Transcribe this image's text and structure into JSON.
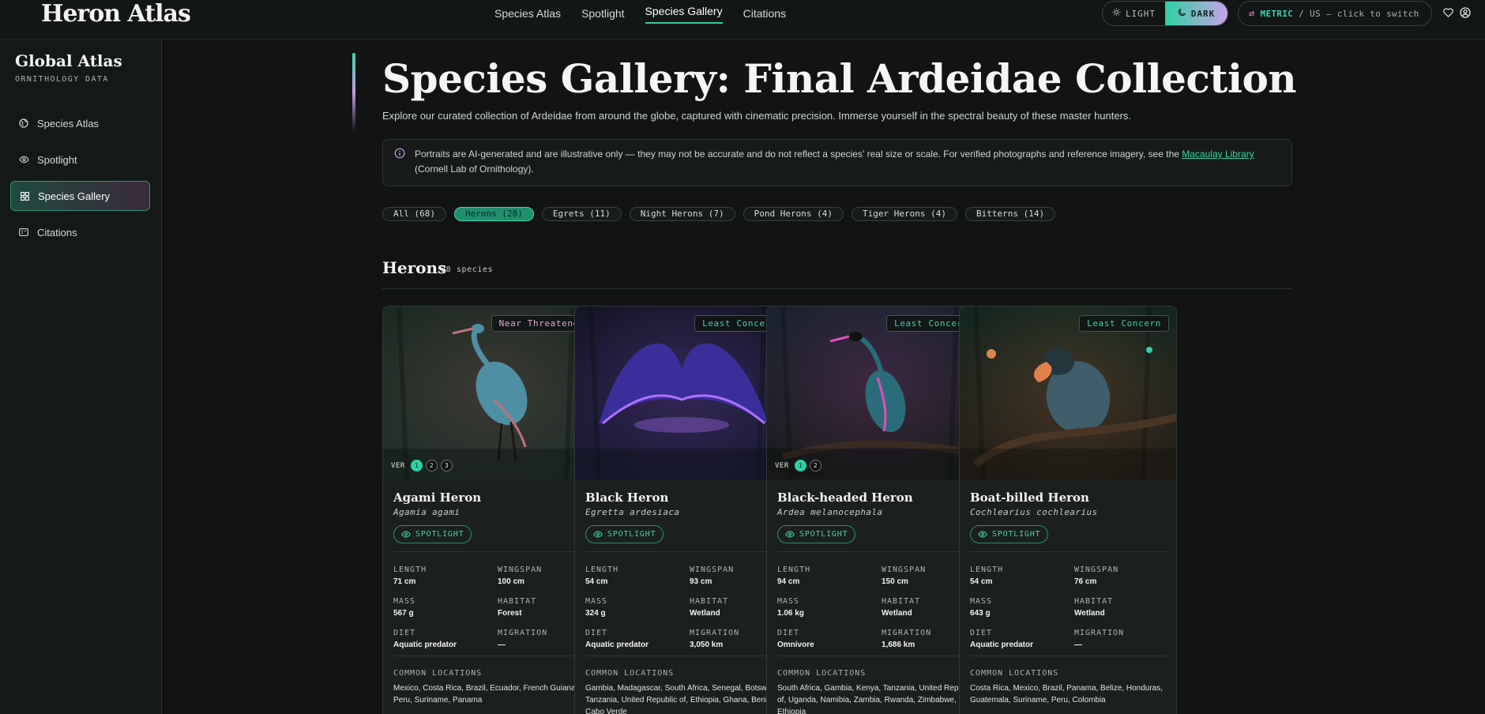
{
  "app": {
    "logo": "Heron Atlas"
  },
  "nav": {
    "items": [
      "Species Atlas",
      "Spotlight",
      "Species Gallery",
      "Citations"
    ],
    "active": "Species Gallery"
  },
  "theme": {
    "light_label": "LIGHT",
    "dark_label": "DARK",
    "selected": "DARK"
  },
  "units": {
    "metric": "METRIC",
    "separator": "/",
    "us": "US",
    "hint": "— click to switch"
  },
  "sidebar": {
    "title": "Global Atlas",
    "subtitle": "ORNITHOLOGY DATA",
    "items": [
      {
        "label": "Species Atlas",
        "icon": "globe-icon"
      },
      {
        "label": "Spotlight",
        "icon": "eye-icon"
      },
      {
        "label": "Species Gallery",
        "icon": "grid-icon"
      },
      {
        "label": "Citations",
        "icon": "book-icon"
      }
    ],
    "active": "Species Gallery"
  },
  "page": {
    "title": "Species Gallery: Final Ardeidae Collection",
    "description": "Explore our curated collection of Ardeidae from around the globe, captured with cinematic precision. Immerse yourself in the spectral beauty of these master hunters.",
    "notice_text": "Portraits are AI-generated and are illustrative only — they may not be accurate and do not reflect a species' real size or scale. For verified photographs and reference imagery, see the",
    "notice_link": "Macaulay Library",
    "notice_tail": "(Cornell Lab of Ornithology)."
  },
  "filters": [
    {
      "label": "All (68)",
      "active": false
    },
    {
      "label": "Herons (28)",
      "active": true
    },
    {
      "label": "Egrets (11)",
      "active": false
    },
    {
      "label": "Night Herons (7)",
      "active": false
    },
    {
      "label": "Pond Herons (4)",
      "active": false
    },
    {
      "label": "Tiger Herons (4)",
      "active": false
    },
    {
      "label": "Bitterns (14)",
      "active": false
    }
  ],
  "section": {
    "title": "Herons",
    "count": "28 species"
  },
  "labels": {
    "ver": "VER",
    "spotlight": "SPOTLIGHT",
    "length": "LENGTH",
    "wingspan": "WINGSPAN",
    "mass": "MASS",
    "habitat": "HABITAT",
    "diet": "DIET",
    "migration": "MIGRATION",
    "locations": "COMMON LOCATIONS"
  },
  "cards": [
    {
      "name": "Agami Heron",
      "latin": "Agamia agami",
      "status": "Near Threatened",
      "status_type": "nt",
      "versions": [
        "1",
        "2",
        "3"
      ],
      "active_version": "1",
      "length": "71 cm",
      "wingspan": "100 cm",
      "mass": "567 g",
      "habitat": "Forest",
      "diet": "Aquatic predator",
      "migration": "—",
      "locations": "Mexico, Costa Rica, Brazil, Ecuador, French Guiana, Peru, Suriname, Panama",
      "palette": {
        "sky": "#1c2a22",
        "ground": "#23302a",
        "bird": "#4f8fa3",
        "accent": "#c0707a"
      }
    },
    {
      "name": "Black Heron",
      "latin": "Egretta ardesiaca",
      "status": "Least Concern",
      "status_type": "lc",
      "versions": [],
      "active_version": "",
      "length": "54 cm",
      "wingspan": "93 cm",
      "mass": "324 g",
      "habitat": "Wetland",
      "diet": "Aquatic predator",
      "migration": "3,050 km",
      "locations": "Gambia, Madagascar, South Africa, Senegal, Botswana, Tanzania, United Republic of, Ethiopia, Ghana, Benin, Cabo Verde",
      "palette": {
        "sky": "#151528",
        "ground": "#1d1b3a",
        "bird": "#3a2f9a",
        "accent": "#b070ff"
      }
    },
    {
      "name": "Black-headed Heron",
      "latin": "Ardea melanocephala",
      "status": "Least Concern",
      "status_type": "lc",
      "versions": [
        "1",
        "2"
      ],
      "active_version": "1",
      "length": "94 cm",
      "wingspan": "150 cm",
      "mass": "1.06 kg",
      "habitat": "Wetland",
      "diet": "Omnivore",
      "migration": "1,686 km",
      "locations": "South Africa, Gambia, Kenya, Tanzania, United Republic of, Uganda, Namibia, Zambia, Rwanda, Zimbabwe, Ethiopia",
      "palette": {
        "sky": "#1a2230",
        "ground": "#1b1c1c",
        "bird": "#2a6c7a",
        "accent": "#e04fb8"
      }
    },
    {
      "name": "Boat-billed Heron",
      "latin": "Cochlearius cochlearius",
      "status": "Least Concern",
      "status_type": "lc",
      "versions": [],
      "active_version": "",
      "length": "54 cm",
      "wingspan": "76 cm",
      "mass": "643 g",
      "habitat": "Wetland",
      "diet": "Aquatic predator",
      "migration": "—",
      "locations": "Costa Rica, Mexico, Brazil, Panama, Belize, Honduras, Guatemala, Suriname, Peru, Colombia",
      "palette": {
        "sky": "#13261f",
        "ground": "#2a2018",
        "bird": "#3f5d6a",
        "accent": "#e0824a"
      }
    }
  ]
}
